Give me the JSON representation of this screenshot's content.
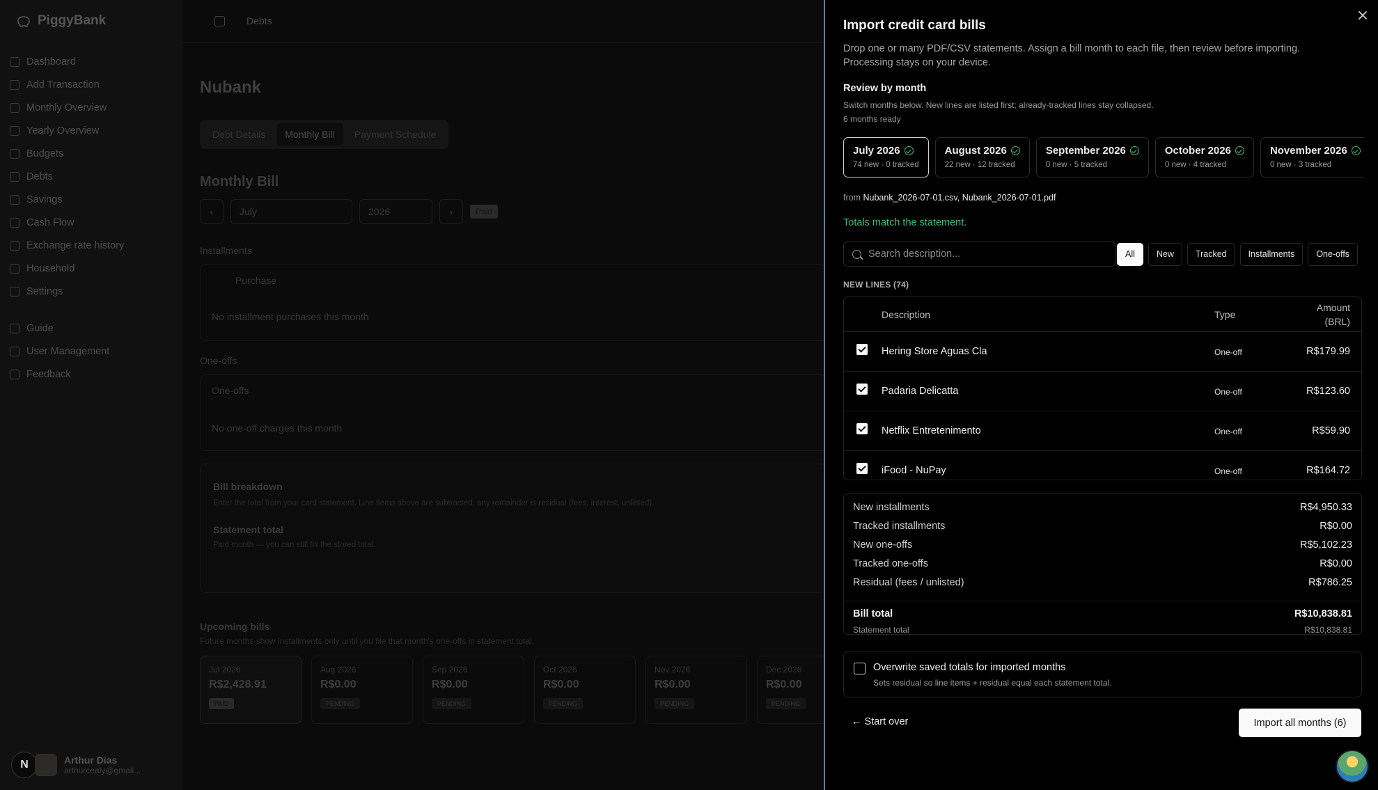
{
  "app": {
    "brand": "PiggyBank",
    "nav": [
      "Dashboard",
      "Add Transaction",
      "Monthly Overview",
      "Yearly Overview",
      "Budgets",
      "Debts",
      "Savings",
      "Cash Flow",
      "Exchange rate history",
      "Household",
      "Settings"
    ],
    "nav2": [
      "Guide",
      "User Management",
      "Feedback"
    ],
    "breadcrumb": "Debts",
    "user": {
      "badge": "N",
      "name": "Arthur Dias",
      "email": "arthurcealy@gmail..."
    },
    "page_title": "Nubank",
    "tabs": [
      "Debt Details",
      "Monthly Bill",
      "Payment Schedule"
    ],
    "section_title": "Monthly Bill",
    "month_select": "July",
    "year_select": "2026",
    "status": "Paid",
    "installments_label": "Installments",
    "purchase_col": "Purchase",
    "no_installments": "No installment purchases this month",
    "oneoffs_label": "One-offs",
    "oneoffs_head": "One-offs",
    "no_oneoffs": "No one-off charges this month",
    "breakdown_title": "Bill breakdown",
    "breakdown_desc": "Enter the total from your card statement. Line items above are subtracted; any remainder is residual (fees, interest, unlisted).",
    "statement_title": "Statement total",
    "statement_desc": "Paid month — you can still fix the stored total.",
    "upcoming_title": "Upcoming bills",
    "upcoming_desc": "Future months show installments only until you file that month's one-offs in statement total.",
    "upcoming": [
      {
        "month": "Jul 2026",
        "value": "R$2,428.91",
        "status": "PAID"
      },
      {
        "month": "Aug 2026",
        "value": "R$0.00",
        "status": "PENDING"
      },
      {
        "month": "Sep 2026",
        "value": "R$0.00",
        "status": "PENDING"
      },
      {
        "month": "Oct 2026",
        "value": "R$0.00",
        "status": "PENDING"
      },
      {
        "month": "Nov 2026",
        "value": "R$0.00",
        "status": "PENDING"
      },
      {
        "month": "Dec 2026",
        "value": "R$0.00",
        "status": "PENDING"
      }
    ]
  },
  "sheet": {
    "title": "Import credit card bills",
    "description": "Drop one or many PDF/CSV statements. Assign a bill month to each file, then review before importing. Processing stays on your device.",
    "review_title": "Review by month",
    "review_sub": "Switch months below. New lines are listed first; already-tracked lines stay collapsed.",
    "ready": "6 months ready",
    "months": [
      {
        "name": "July 2026",
        "stats": "74 new · 0 tracked"
      },
      {
        "name": "August 2026",
        "stats": "22 new · 12 tracked"
      },
      {
        "name": "September 2026",
        "stats": "0 new · 5 tracked"
      },
      {
        "name": "October 2026",
        "stats": "0 new · 4 tracked"
      },
      {
        "name": "November 2026",
        "stats": "0 new · 3 tracked"
      }
    ],
    "from_label": "from",
    "from_files": "Nubank_2026-07-01.csv, Nubank_2026-07-01.pdf",
    "match_text": "Totals match the statement.",
    "search_placeholder": "Search description...",
    "filters": [
      "All",
      "New",
      "Tracked",
      "Installments",
      "One-offs"
    ],
    "new_lines_label": "NEW LINES (74)",
    "columns": {
      "description": "Description",
      "type": "Type",
      "amount_1": "Amount",
      "amount_2": "(BRL)"
    },
    "rows": [
      {
        "description": "Hering Store Aguas Cla",
        "type": "One-off",
        "amount": "R$179.99"
      },
      {
        "description": "Padaria Delicatta",
        "type": "One-off",
        "amount": "R$123.60"
      },
      {
        "description": "Netflix Entretenimento",
        "type": "One-off",
        "amount": "R$59.90"
      },
      {
        "description": "iFood - NuPay",
        "type": "One-off",
        "amount": "R$164.72"
      }
    ],
    "totals": [
      {
        "label": "New installments",
        "value": "R$4,950.33"
      },
      {
        "label": "Tracked installments",
        "value": "R$0.00"
      },
      {
        "label": "New one-offs",
        "value": "R$5,102.23"
      },
      {
        "label": "Tracked one-offs",
        "value": "R$0.00"
      },
      {
        "label": "Residual (fees / unlisted)",
        "value": "R$786.25"
      }
    ],
    "bill_total_label": "Bill total",
    "bill_total": "R$10,838.81",
    "statement_total_label": "Statement total",
    "statement_total": "R$10,838.81",
    "overwrite_title": "Overwrite saved totals for imported months",
    "overwrite_sub": "Sets residual so line items + residual equal each statement total.",
    "start_over": "← Start over",
    "import_button": "Import all months (6)"
  }
}
